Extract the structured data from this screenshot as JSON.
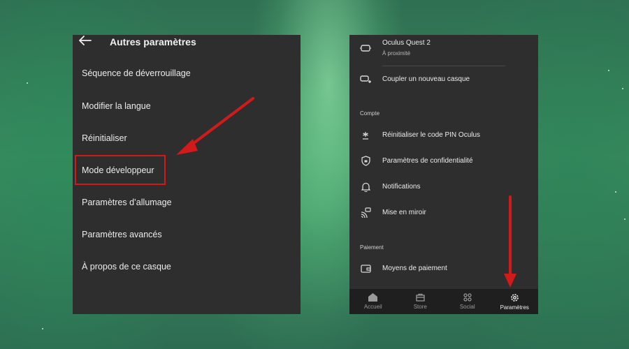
{
  "left_panel": {
    "title": "Autres paramètres",
    "back_icon": "arrow-left-icon",
    "items": [
      {
        "label": "Séquence de déverrouillage"
      },
      {
        "label": "Modifier la langue"
      },
      {
        "label": "Réinitialiser"
      },
      {
        "label": "Mode développeur"
      },
      {
        "label": "Paramètres d’allumage"
      },
      {
        "label": "Paramètres avancés"
      },
      {
        "label": "À propos de ce casque"
      }
    ]
  },
  "right_panel": {
    "device": {
      "name": "Oculus Quest 2",
      "status": "À proximité",
      "icon": "headset-icon"
    },
    "pair": {
      "label": "Coupler un nouveau casque",
      "icon": "headset-add-icon"
    },
    "section_account": "Compte",
    "account_items": [
      {
        "label": "Réinitialiser le code PIN Oculus",
        "icon": "asterisk-icon"
      },
      {
        "label": "Paramètres de confidentialité",
        "icon": "shield-lock-icon"
      },
      {
        "label": "Notifications",
        "icon": "bell-icon"
      },
      {
        "label": "Mise en miroir",
        "icon": "cast-icon"
      }
    ],
    "section_payment": "Paiement",
    "payment_items": [
      {
        "label": "Moyens de paiement",
        "icon": "wallet-icon"
      }
    ],
    "nav": [
      {
        "label": "Accueil",
        "icon": "home-icon",
        "active": false
      },
      {
        "label": "Store",
        "icon": "store-icon",
        "active": false
      },
      {
        "label": "Social",
        "icon": "social-icon",
        "active": false
      },
      {
        "label": "Paramètres",
        "icon": "gear-icon",
        "active": true
      }
    ]
  },
  "colors": {
    "panel_bg": "#2e2e2e",
    "nav_bg": "#1f1f1f",
    "annotation_red": "#d11a1a",
    "text": "#ececec"
  }
}
